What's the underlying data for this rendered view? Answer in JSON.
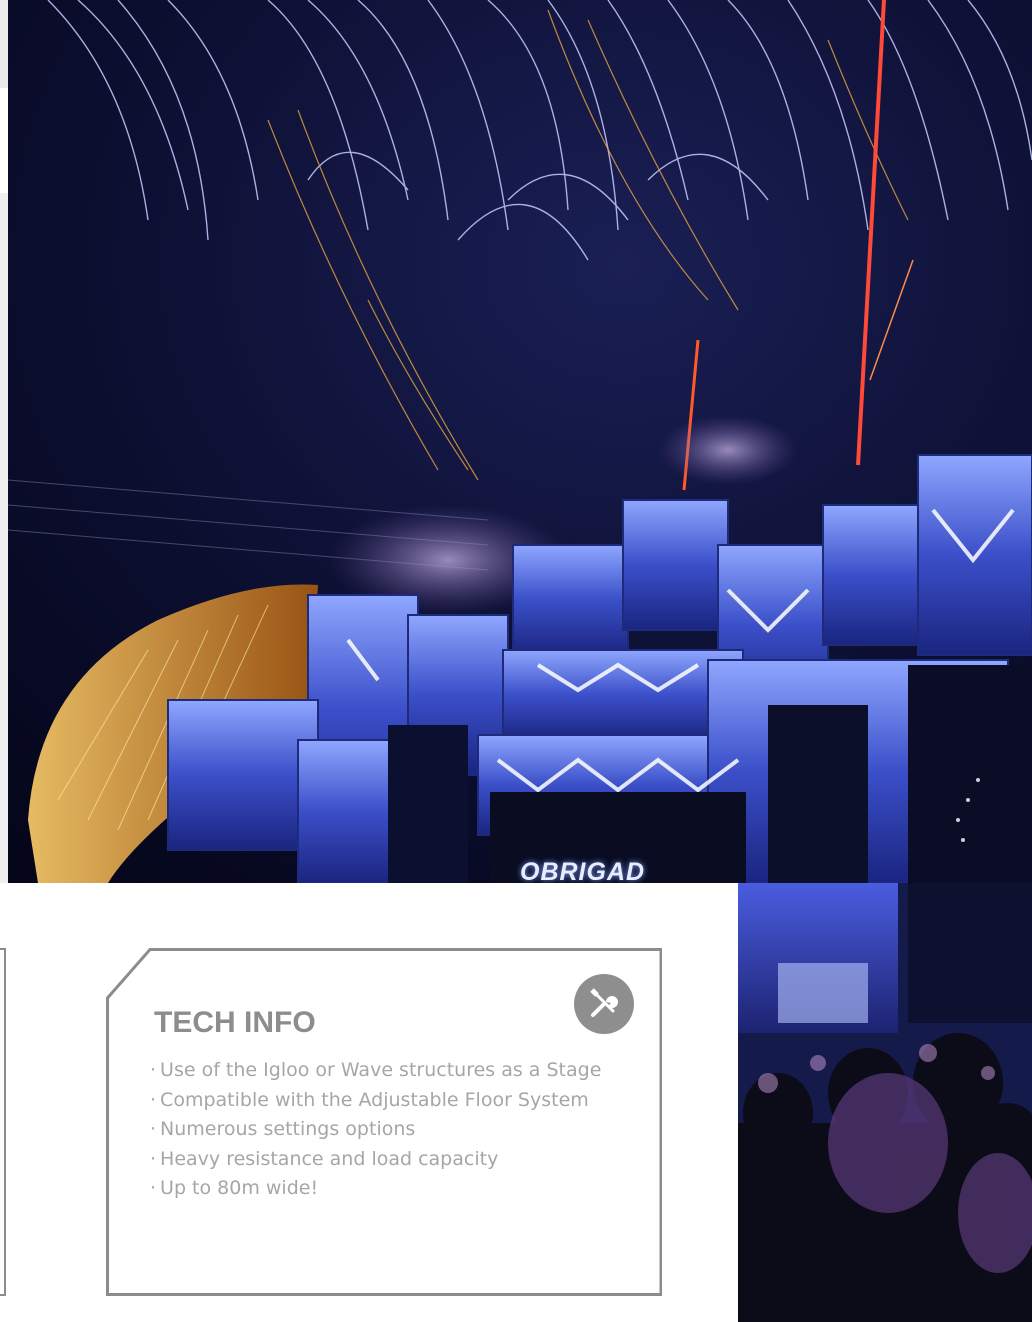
{
  "photo": {
    "stage_screen_text": "OBRIGAD"
  },
  "tech_info": {
    "title": "TECH INFO",
    "icon": "tools-icon",
    "bullet": "·",
    "features": [
      "Use of the Igloo or Wave structures as a Stage",
      "Compatible with the Adjustable Floor System",
      "Numerous settings options",
      "Heavy resistance and load capacity",
      "Up to 80m wide!"
    ]
  },
  "colors": {
    "card_border": "#8c8c8c",
    "title": "#8d8d8d",
    "text": "#a6a6a6",
    "badge": "#8e8e8e"
  }
}
